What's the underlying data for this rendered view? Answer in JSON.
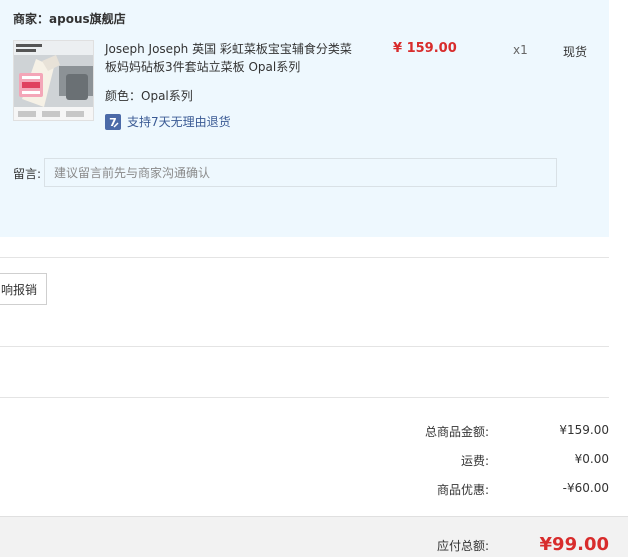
{
  "shop": {
    "merchant_label": "商家：",
    "merchant_name": "apous旗舰店"
  },
  "item": {
    "title": "Joseph Joseph 英国 彩虹菜板宝宝辅食分类菜板妈妈砧板3件套站立菜板 Opal系列",
    "color_label": "颜色：",
    "color_value": "Opal系列",
    "return_policy": "支持7天无理由退货",
    "return_icon_glyph": "7",
    "price": "¥ 159.00",
    "quantity": "x1",
    "stock": "现货",
    "thumb_icon": "product-photo"
  },
  "message": {
    "label": "留言:",
    "placeholder": "建议留言前先与商家沟通确认"
  },
  "invoice": {
    "button_label": "响报销"
  },
  "summary": {
    "goods_total_label": "总商品金额:",
    "goods_total_value": "¥159.00",
    "shipping_label": "运费:",
    "shipping_value": "¥0.00",
    "discount_label": "商品优惠:",
    "discount_value": "-¥60.00",
    "payable_label": "应付总额:",
    "payable_value": "¥99.00"
  },
  "colors": {
    "accent_red": "#d82c2c",
    "panel_blue": "#eef8fe",
    "link_blue": "#3a5a94"
  }
}
